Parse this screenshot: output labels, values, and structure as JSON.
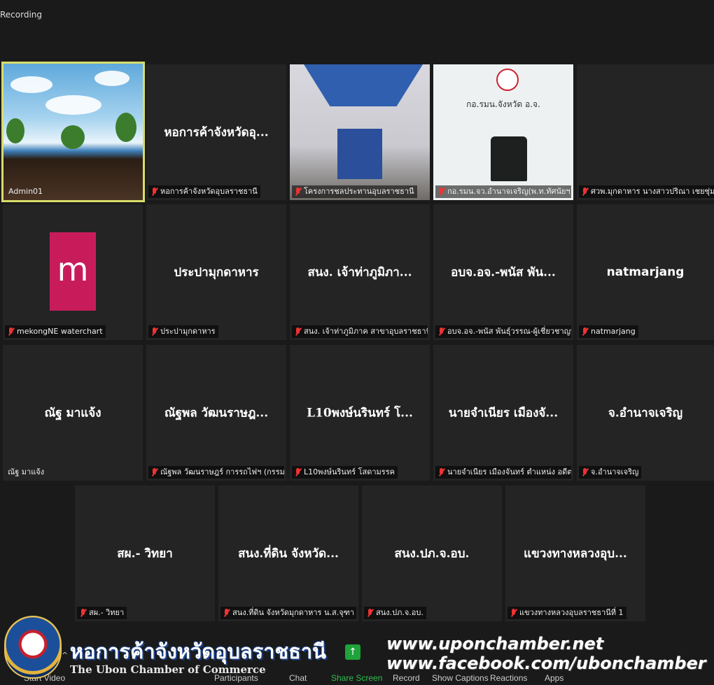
{
  "status": {
    "recording": "Recording"
  },
  "tiles": [
    {
      "center": "",
      "name": "Admin01",
      "muted": false
    },
    {
      "center": "หอการค้าจังหวัดอุ...",
      "name": "หอการค้าจังหวัดอุบลราชธานี",
      "muted": true
    },
    {
      "center": "",
      "name": "โครงการชลประทานอุบลราชธานี",
      "muted": true
    },
    {
      "center": "",
      "name": "กอ.รมน.จว.อำนาจเจริญ(พ.ท.ทัศนัยฯ)",
      "muted": true,
      "sign": "กอ.รมน.จังหวัด อ.จ."
    },
    {
      "center": "",
      "name": "ศวพ.มุกดาหาร นางสาวปริณา เชยชุ่ม ผอ...",
      "muted": true
    },
    {
      "center": "",
      "name": "mekongNE waterchart",
      "muted": true,
      "logo": "m"
    },
    {
      "center": "ประปามุกดาหาร",
      "name": "ประปามุกดาหาร",
      "muted": true
    },
    {
      "center": "สนง. เจ้าท่าภูมิภา...",
      "name": "สนง. เจ้าท่าภูมิภาค สาขาอุบลราชธานี",
      "muted": true
    },
    {
      "center": "อบจ.อจ.-พนัส พัน...",
      "name": "อบจ.อจ.-พนัส พันธุ์วรรณ-ผู้เชี่ยวชาญพิ...",
      "muted": true
    },
    {
      "center": "natmarjang",
      "name": "natmarjang",
      "muted": true
    },
    {
      "center": "ณัฐ มาแจ้ง",
      "name": "ณัฐ มาแจ้ง",
      "muted": false
    },
    {
      "center": "ณัฐพล วัฒนราษฎ...",
      "name": "ณัฐพล วัฒนราษฎร์ การรถไฟฯ (กรรมการ...",
      "muted": true
    },
    {
      "center": "L10พงษ์นรินทร์ โ...",
      "name": "L10พงษ์นรินทร์ โสดามรรค",
      "muted": true
    },
    {
      "center": "นายจำเนียร เมืองจั...",
      "name": "นายจำเนียร เมืองจันทร์ ตำแหน่ง อดีตพน...",
      "muted": true
    },
    {
      "center": "จ.อำนาจเจริญ",
      "name": "จ.อำนาจเจริญ",
      "muted": true
    },
    {
      "center": "สผ.- วิทยา",
      "name": "สผ.- วิทยา",
      "muted": true
    },
    {
      "center": "สนง.ที่ดิน จังหวัด...",
      "name": "สนง.ที่ดิน จังหวัดมุกดาหาร น.ส.จุฑา วงษ์...",
      "muted": true
    },
    {
      "center": "สนง.ปภ.จ.อบ.",
      "name": "สนง.ปภ.จ.อบ.",
      "muted": true
    },
    {
      "center": "แขวงทางหลวงอุบ...",
      "name": "แขวงทางหลวงอุบลราชธานีที่ 1",
      "muted": true
    }
  ],
  "toolbar": {
    "start_video": "Start Video",
    "participants": "Participants",
    "chat": "Chat",
    "share_screen": "Share Screen",
    "record": "Record",
    "show_captions": "Show Captions",
    "reactions": "Reactions",
    "apps": "Apps"
  },
  "watermark": {
    "title_th": "หอการค้าจังหวัดอุบลราชธานี",
    "title_en": "The Ubon Chamber of Commerce",
    "url1": "www.uponchamber.net",
    "url2": "www.facebook.com/ubonchamber"
  },
  "colors": {
    "active_border": "#d8dc6a",
    "share_green": "#1fa33b",
    "logo_pink": "#c81c5a",
    "mute_red": "#e33333"
  }
}
